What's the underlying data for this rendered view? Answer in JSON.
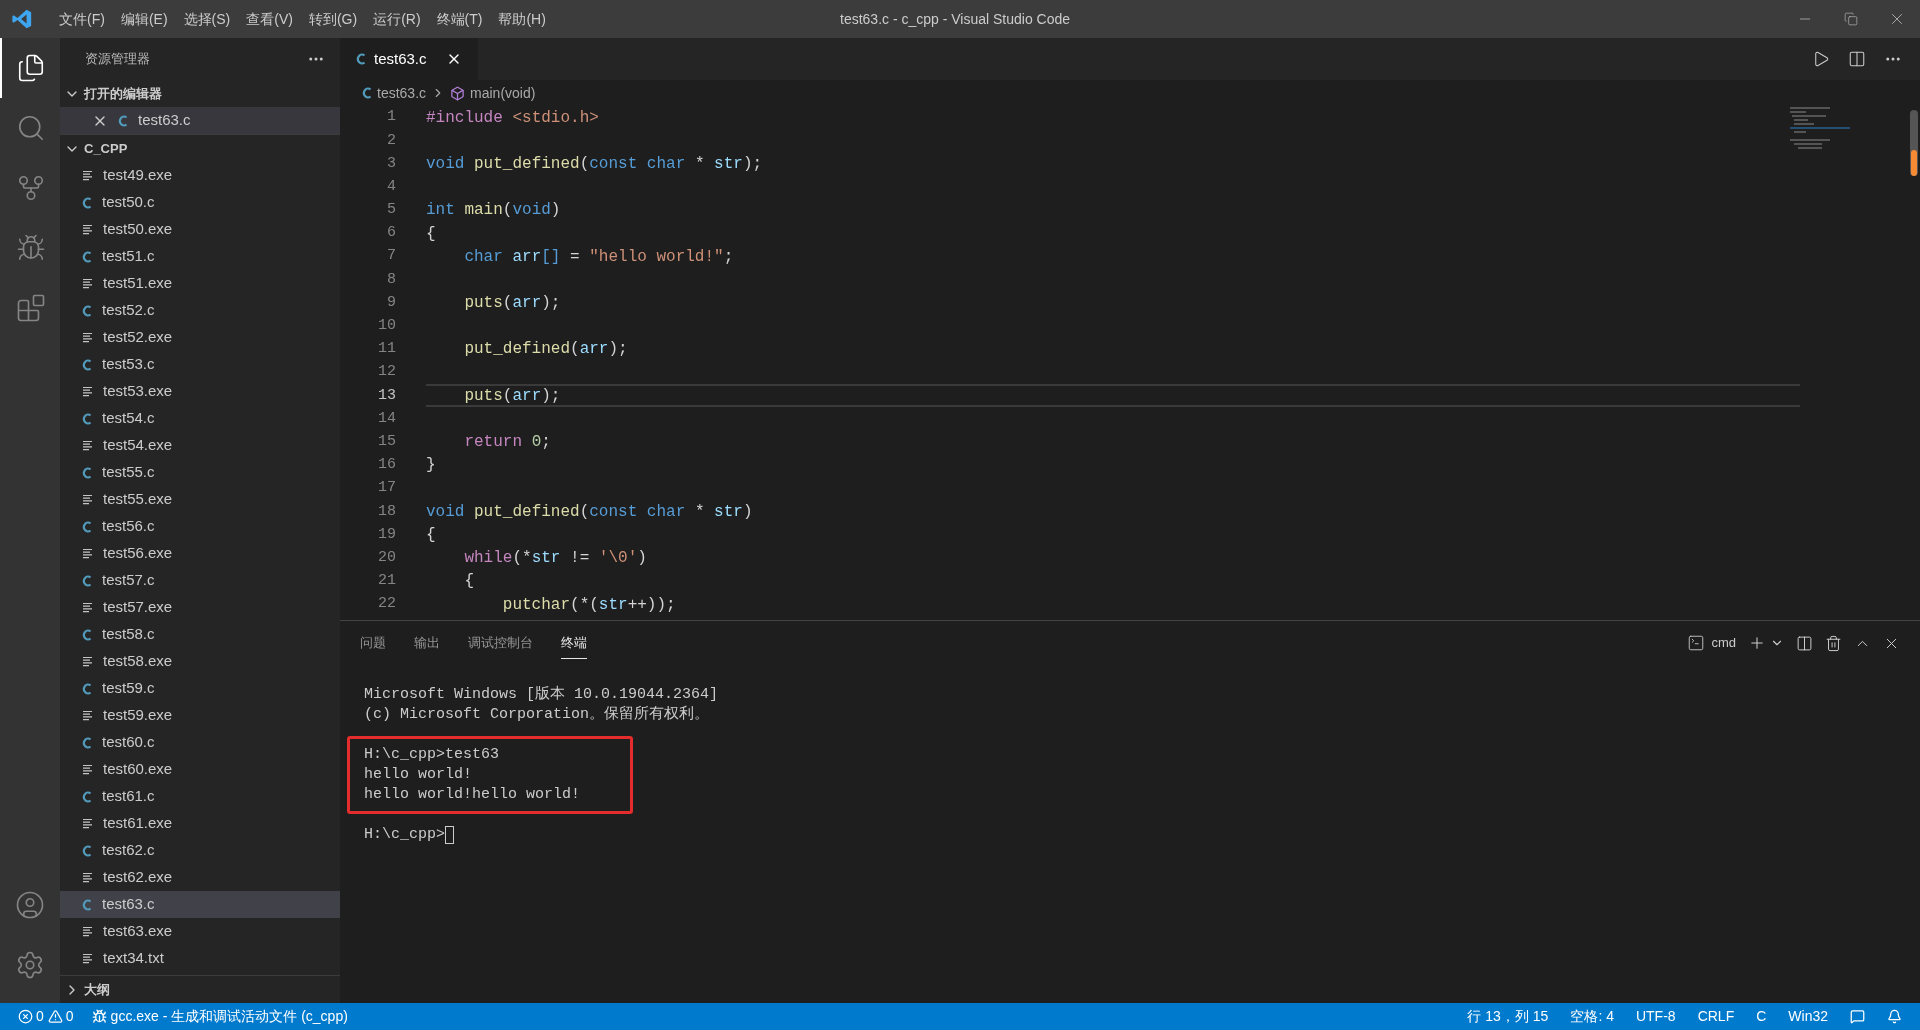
{
  "title_bar": {
    "menus": [
      "文件(F)",
      "编辑(E)",
      "选择(S)",
      "查看(V)",
      "转到(G)",
      "运行(R)",
      "终端(T)",
      "帮助(H)"
    ],
    "title": "test63.c - c_cpp - Visual Studio Code"
  },
  "activity_bar": {
    "items": [
      {
        "kind": "explorer",
        "selected": true
      },
      {
        "kind": "search",
        "selected": false
      },
      {
        "kind": "scm",
        "selected": false
      },
      {
        "kind": "debug",
        "selected": false
      },
      {
        "kind": "extensions",
        "selected": false
      }
    ],
    "bottom": [
      {
        "kind": "account"
      },
      {
        "kind": "settings"
      }
    ]
  },
  "sidebar": {
    "title": "资源管理器",
    "open_editors": {
      "label": "打开的编辑器",
      "expanded": true,
      "items": [
        {
          "name": "test63.c",
          "kind": "c",
          "selected": true
        }
      ]
    },
    "folder": {
      "label": "C_CPP",
      "expanded": true,
      "items": [
        {
          "name": "test49.exe",
          "kind": "exe",
          "selected": false
        },
        {
          "name": "test50.c",
          "kind": "c",
          "selected": false
        },
        {
          "name": "test50.exe",
          "kind": "exe",
          "selected": false
        },
        {
          "name": "test51.c",
          "kind": "c",
          "selected": false
        },
        {
          "name": "test51.exe",
          "kind": "exe",
          "selected": false
        },
        {
          "name": "test52.c",
          "kind": "c",
          "selected": false
        },
        {
          "name": "test52.exe",
          "kind": "exe",
          "selected": false
        },
        {
          "name": "test53.c",
          "kind": "c",
          "selected": false
        },
        {
          "name": "test53.exe",
          "kind": "exe",
          "selected": false
        },
        {
          "name": "test54.c",
          "kind": "c",
          "selected": false
        },
        {
          "name": "test54.exe",
          "kind": "exe",
          "selected": false
        },
        {
          "name": "test55.c",
          "kind": "c",
          "selected": false
        },
        {
          "name": "test55.exe",
          "kind": "exe",
          "selected": false
        },
        {
          "name": "test56.c",
          "kind": "c",
          "selected": false
        },
        {
          "name": "test56.exe",
          "kind": "exe",
          "selected": false
        },
        {
          "name": "test57.c",
          "kind": "c",
          "selected": false
        },
        {
          "name": "test57.exe",
          "kind": "exe",
          "selected": false
        },
        {
          "name": "test58.c",
          "kind": "c",
          "selected": false
        },
        {
          "name": "test58.exe",
          "kind": "exe",
          "selected": false
        },
        {
          "name": "test59.c",
          "kind": "c",
          "selected": false
        },
        {
          "name": "test59.exe",
          "kind": "exe",
          "selected": false
        },
        {
          "name": "test60.c",
          "kind": "c",
          "selected": false
        },
        {
          "name": "test60.exe",
          "kind": "exe",
          "selected": false
        },
        {
          "name": "test61.c",
          "kind": "c",
          "selected": false
        },
        {
          "name": "test61.exe",
          "kind": "exe",
          "selected": false
        },
        {
          "name": "test62.c",
          "kind": "c",
          "selected": false
        },
        {
          "name": "test62.exe",
          "kind": "exe",
          "selected": false
        },
        {
          "name": "test63.c",
          "kind": "c",
          "selected": true
        },
        {
          "name": "test63.exe",
          "kind": "exe",
          "selected": false
        },
        {
          "name": "text34.txt",
          "kind": "exe",
          "selected": false
        }
      ]
    },
    "outline": {
      "label": "大纲",
      "expanded": false
    }
  },
  "editor": {
    "tabs": [
      {
        "label": "test63.c",
        "kind": "c",
        "selected": true
      }
    ],
    "breadcrumb": [
      "test63.c",
      "main(void)"
    ],
    "lines": [
      {
        "number": "1",
        "current": false,
        "tokens": [
          {
            "kind": "pre",
            "text": "#include "
          },
          {
            "kind": "inc",
            "text": "<stdio.h>"
          }
        ]
      },
      {
        "number": "2",
        "current": false
      },
      {
        "number": "3",
        "current": false,
        "tokens": [
          {
            "kind": "kw",
            "text": "void "
          },
          {
            "kind": "fn",
            "text": "put_defined"
          },
          {
            "kind": "p",
            "text": "("
          },
          {
            "kind": "kw",
            "text": "const char "
          },
          {
            "kind": "p",
            "text": "* "
          },
          {
            "kind": "var",
            "text": "str"
          },
          {
            "kind": "p",
            "text": ");"
          }
        ]
      },
      {
        "number": "4",
        "current": false
      },
      {
        "number": "5",
        "current": false,
        "tokens": [
          {
            "kind": "kw",
            "text": "int "
          },
          {
            "kind": "fn",
            "text": "main"
          },
          {
            "kind": "p",
            "text": "("
          },
          {
            "kind": "kw",
            "text": "void"
          },
          {
            "kind": "p",
            "text": ")"
          }
        ]
      },
      {
        "number": "6",
        "current": false,
        "tokens": [
          {
            "kind": "p",
            "text": "{"
          }
        ]
      },
      {
        "number": "7",
        "current": false,
        "tokens": [
          {
            "kind": "kw",
            "text": "    char "
          },
          {
            "kind": "var",
            "text": "arr"
          },
          {
            "kind": "kw",
            "text": "[]"
          },
          {
            "kind": "p",
            "text": " = "
          },
          {
            "kind": "str",
            "text": "\"hello world!\""
          },
          {
            "kind": "p",
            "text": ";"
          }
        ]
      },
      {
        "number": "8",
        "current": false
      },
      {
        "number": "9",
        "current": false,
        "tokens": [
          {
            "kind": "fn",
            "text": "    puts"
          },
          {
            "kind": "p",
            "text": "("
          },
          {
            "kind": "var",
            "text": "arr"
          },
          {
            "kind": "p",
            "text": ");"
          }
        ]
      },
      {
        "number": "10",
        "current": false
      },
      {
        "number": "11",
        "current": false,
        "tokens": [
          {
            "kind": "fn",
            "text": "    put_defined"
          },
          {
            "kind": "p",
            "text": "("
          },
          {
            "kind": "var",
            "text": "arr"
          },
          {
            "kind": "p",
            "text": ");"
          }
        ]
      },
      {
        "number": "12",
        "current": false
      },
      {
        "number": "13",
        "current": true,
        "tokens": [
          {
            "kind": "fn",
            "text": "    puts"
          },
          {
            "kind": "p",
            "text": "("
          },
          {
            "kind": "var",
            "text": "arr"
          },
          {
            "kind": "p",
            "text": ");"
          }
        ]
      },
      {
        "number": "14",
        "current": false
      },
      {
        "number": "15",
        "current": false,
        "tokens": [
          {
            "kind": "ctl",
            "text": "    return "
          },
          {
            "kind": "num",
            "text": "0"
          },
          {
            "kind": "p",
            "text": ";"
          }
        ]
      },
      {
        "number": "16",
        "current": false,
        "tokens": [
          {
            "kind": "p",
            "text": "}"
          }
        ]
      },
      {
        "number": "17",
        "current": false
      },
      {
        "number": "18",
        "current": false,
        "tokens": [
          {
            "kind": "kw",
            "text": "void "
          },
          {
            "kind": "fn",
            "text": "put_defined"
          },
          {
            "kind": "p",
            "text": "("
          },
          {
            "kind": "kw",
            "text": "const char "
          },
          {
            "kind": "p",
            "text": "* "
          },
          {
            "kind": "var",
            "text": "str"
          },
          {
            "kind": "p",
            "text": ")"
          }
        ]
      },
      {
        "number": "19",
        "current": false,
        "tokens": [
          {
            "kind": "p",
            "text": "{"
          }
        ]
      },
      {
        "number": "20",
        "current": false,
        "tokens": [
          {
            "kind": "ctl",
            "text": "    while"
          },
          {
            "kind": "p",
            "text": "(*"
          },
          {
            "kind": "var",
            "text": "str"
          },
          {
            "kind": "p",
            "text": " != "
          },
          {
            "kind": "str",
            "text": "'\\0'"
          },
          {
            "kind": "p",
            "text": ")"
          }
        ]
      },
      {
        "number": "21",
        "current": false,
        "tokens": [
          {
            "kind": "p",
            "text": "    {"
          }
        ]
      },
      {
        "number": "22",
        "current": false,
        "tokens": [
          {
            "kind": "fn",
            "text": "        putchar"
          },
          {
            "kind": "p",
            "text": "(*("
          },
          {
            "kind": "var",
            "text": "str"
          },
          {
            "kind": "p",
            "text": "++));"
          }
        ]
      }
    ]
  },
  "panel": {
    "tabs": [
      {
        "label": "问题",
        "selected": false
      },
      {
        "label": "输出",
        "selected": false
      },
      {
        "label": "调试控制台",
        "selected": false
      },
      {
        "label": "终端",
        "selected": true
      }
    ],
    "shell": "cmd",
    "output": [
      {
        "highlighted": false,
        "lines": [
          "Microsoft Windows [版本 10.0.19044.2364]",
          "(c) Microsoft Corporation。保留所有权利。"
        ]
      },
      {
        "highlighted": true,
        "lines": [
          "H:\\c_cpp>test63",
          "hello world!",
          "hello world!hello world!"
        ]
      }
    ],
    "prompt": "H:\\c_cpp>"
  },
  "status_bar": {
    "errors": "0",
    "warnings": "0",
    "task": "gcc.exe - 生成和调试活动文件 (c_cpp)",
    "items": [
      "行 13，列 15",
      "空格: 4",
      "UTF-8",
      "CRLF",
      "C",
      "Win32"
    ]
  }
}
